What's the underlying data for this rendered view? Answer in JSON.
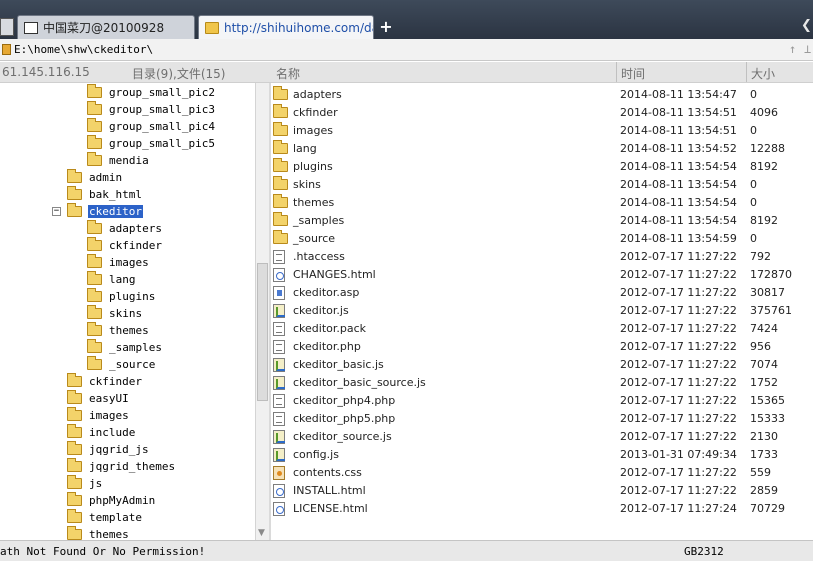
{
  "tabs": [
    {
      "label": "中国菜刀@20100928"
    },
    {
      "label": "http://shihuihome.com/data/..."
    }
  ],
  "new_tab_label": "+",
  "path": {
    "value": "E:\\home\\shw\\ckeditor\\",
    "btn_up": "↑",
    "btn_other": "⊥"
  },
  "header": {
    "host": "61.145.116.15",
    "summary": "目录(9),文件(15)",
    "col_name": "名称",
    "col_time": "时间",
    "col_size": "大小"
  },
  "tree": [
    {
      "label": "group_small_pic2"
    },
    {
      "label": "group_small_pic3"
    },
    {
      "label": "group_small_pic4"
    },
    {
      "label": "group_small_pic5"
    },
    {
      "label": "mendia"
    },
    {
      "label": "admin"
    },
    {
      "label": "bak_html"
    },
    {
      "label": "ckeditor",
      "expander": "−"
    },
    {
      "label": "adapters"
    },
    {
      "label": "ckfinder"
    },
    {
      "label": "images"
    },
    {
      "label": "lang"
    },
    {
      "label": "plugins"
    },
    {
      "label": "skins"
    },
    {
      "label": "themes"
    },
    {
      "label": "_samples"
    },
    {
      "label": "_source"
    },
    {
      "label": "ckfinder"
    },
    {
      "label": "easyUI"
    },
    {
      "label": "images"
    },
    {
      "label": "include"
    },
    {
      "label": "jqgrid_js"
    },
    {
      "label": "jqgrid_themes"
    },
    {
      "label": "js"
    },
    {
      "label": "phpMyAdmin"
    },
    {
      "label": "template"
    },
    {
      "label": "themes"
    }
  ],
  "files": [
    {
      "name": "adapters",
      "time": "2014-08-11 13:54:47",
      "size": "0",
      "icon": "folder"
    },
    {
      "name": "ckfinder",
      "time": "2014-08-11 13:54:51",
      "size": "4096",
      "icon": "folder"
    },
    {
      "name": "images",
      "time": "2014-08-11 13:54:51",
      "size": "0",
      "icon": "folder"
    },
    {
      "name": "lang",
      "time": "2014-08-11 13:54:52",
      "size": "12288",
      "icon": "folder"
    },
    {
      "name": "plugins",
      "time": "2014-08-11 13:54:54",
      "size": "8192",
      "icon": "folder"
    },
    {
      "name": "skins",
      "time": "2014-08-11 13:54:54",
      "size": "0",
      "icon": "folder"
    },
    {
      "name": "themes",
      "time": "2014-08-11 13:54:54",
      "size": "0",
      "icon": "folder"
    },
    {
      "name": "_samples",
      "time": "2014-08-11 13:54:54",
      "size": "8192",
      "icon": "folder"
    },
    {
      "name": "_source",
      "time": "2014-08-11 13:54:59",
      "size": "0",
      "icon": "folder"
    },
    {
      "name": ".htaccess",
      "time": "2012-07-17 11:27:22",
      "size": "792",
      "icon": "plain"
    },
    {
      "name": "CHANGES.html",
      "time": "2012-07-17 11:27:22",
      "size": "172870",
      "icon": "html"
    },
    {
      "name": "ckeditor.asp",
      "time": "2012-07-17 11:27:22",
      "size": "30817",
      "icon": "asp"
    },
    {
      "name": "ckeditor.js",
      "time": "2012-07-17 11:27:22",
      "size": "375761",
      "icon": "js"
    },
    {
      "name": "ckeditor.pack",
      "time": "2012-07-17 11:27:22",
      "size": "7424",
      "icon": "plain"
    },
    {
      "name": "ckeditor.php",
      "time": "2012-07-17 11:27:22",
      "size": "956",
      "icon": "plain"
    },
    {
      "name": "ckeditor_basic.js",
      "time": "2012-07-17 11:27:22",
      "size": "7074",
      "icon": "js"
    },
    {
      "name": "ckeditor_basic_source.js",
      "time": "2012-07-17 11:27:22",
      "size": "1752",
      "icon": "js"
    },
    {
      "name": "ckeditor_php4.php",
      "time": "2012-07-17 11:27:22",
      "size": "15365",
      "icon": "plain"
    },
    {
      "name": "ckeditor_php5.php",
      "time": "2012-07-17 11:27:22",
      "size": "15333",
      "icon": "plain"
    },
    {
      "name": "ckeditor_source.js",
      "time": "2012-07-17 11:27:22",
      "size": "2130",
      "icon": "js"
    },
    {
      "name": "config.js",
      "time": "2013-01-31 07:49:34",
      "size": "1733",
      "icon": "js"
    },
    {
      "name": "contents.css",
      "time": "2012-07-17 11:27:22",
      "size": "559",
      "icon": "css"
    },
    {
      "name": "INSTALL.html",
      "time": "2012-07-17 11:27:22",
      "size": "2859",
      "icon": "html"
    },
    {
      "name": "LICENSE.html",
      "time": "2012-07-17 11:27:24",
      "size": "70729",
      "icon": "html"
    }
  ],
  "status": {
    "message": "ath Not Found Or No Permission!",
    "encoding": "GB2312"
  }
}
